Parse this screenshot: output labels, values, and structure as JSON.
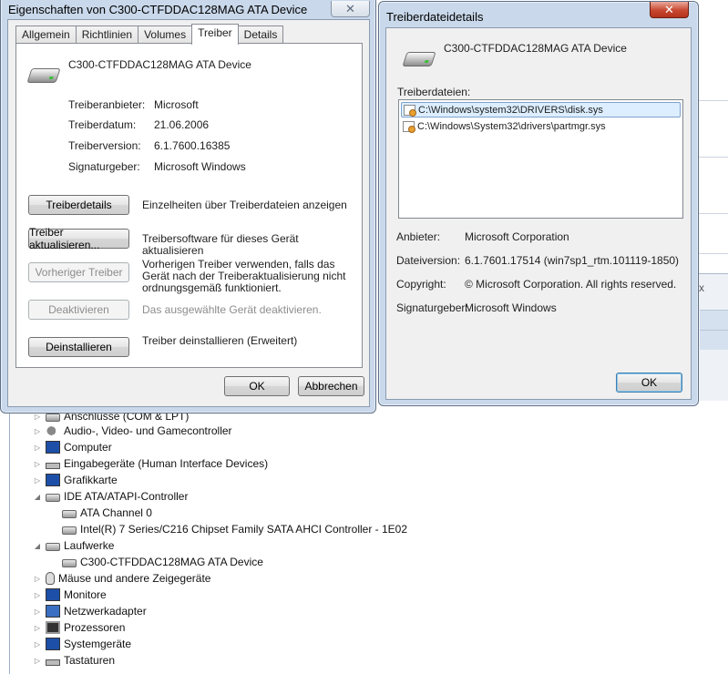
{
  "props_dialog": {
    "title": "Eigenschaften von C300-CTFDDAC128MAG ATA Device",
    "close_glyph": "✕",
    "tabs": [
      "Allgemein",
      "Richtlinien",
      "Volumes",
      "Treiber",
      "Details"
    ],
    "active_tab": "Treiber",
    "device_name": "C300-CTFDDAC128MAG ATA Device",
    "fields": [
      {
        "label": "Treiberanbieter:",
        "value": "Microsoft"
      },
      {
        "label": "Treiberdatum:",
        "value": "21.06.2006"
      },
      {
        "label": "Treiberversion:",
        "value": "6.1.7600.16385"
      },
      {
        "label": "Signaturgeber:",
        "value": "Microsoft Windows"
      }
    ],
    "actions": [
      {
        "button": "Treiberdetails",
        "description": "Einzelheiten über Treiberdateien anzeigen",
        "enabled": true
      },
      {
        "button": "Treiber aktualisieren...",
        "description": "Treibersoftware für dieses Gerät aktualisieren",
        "enabled": true
      },
      {
        "button": "Vorheriger Treiber",
        "description": "Vorherigen Treiber verwenden, falls das Gerät nach der Treiberaktualisierung nicht ordnungsgemäß funktioniert.",
        "enabled": false
      },
      {
        "button": "Deaktivieren",
        "description": "Das ausgewählte Gerät deaktivieren.",
        "enabled": false
      },
      {
        "button": "Deinstallieren",
        "description": "Treiber deinstallieren (Erweitert)",
        "enabled": true
      }
    ],
    "ok_label": "OK",
    "cancel_label": "Abbrechen"
  },
  "details_dialog": {
    "title": "Treiberdateidetails",
    "close_glyph": "✕",
    "device_name": "C300-CTFDDAC128MAG ATA Device",
    "files_label": "Treiberdateien:",
    "files": [
      "C:\\Windows\\system32\\DRIVERS\\disk.sys",
      "C:\\Windows\\System32\\drivers\\partmgr.sys"
    ],
    "selected_file_index": 0,
    "fields": [
      {
        "label": "Anbieter:",
        "value": "Microsoft Corporation"
      },
      {
        "label": "Dateiversion:",
        "value": "6.1.7601.17514 (win7sp1_rtm.101119-1850)"
      },
      {
        "label": "Copyright:",
        "value": "© Microsoft Corporation. All rights reserved."
      },
      {
        "label": "Signaturgeber:",
        "value": "Microsoft Windows"
      }
    ],
    "ok_label": "OK"
  },
  "device_tree": {
    "items": [
      {
        "label": "Anschlüsse (COM & LPT)",
        "icon": "port-icon",
        "level": 0,
        "expander": "▷"
      },
      {
        "label": "Audio-, Video- und Gamecontroller",
        "icon": "speaker-icon",
        "level": 0,
        "expander": "▷"
      },
      {
        "label": "Computer",
        "icon": "computer-icon",
        "level": 0,
        "expander": "▷"
      },
      {
        "label": "Eingabegeräte (Human Interface Devices)",
        "icon": "hid-icon",
        "level": 0,
        "expander": "▷"
      },
      {
        "label": "Grafikkarte",
        "icon": "display-adapter-icon",
        "level": 0,
        "expander": "▷"
      },
      {
        "label": "IDE ATA/ATAPI-Controller",
        "icon": "ide-controller-icon",
        "level": 0,
        "expander": "◢"
      },
      {
        "label": "ATA Channel 0",
        "icon": "ide-controller-icon",
        "level": 1,
        "expander": ""
      },
      {
        "label": "Intel(R) 7 Series/C216 Chipset Family SATA AHCI Controller - 1E02",
        "icon": "ide-controller-icon",
        "level": 1,
        "expander": ""
      },
      {
        "label": "Laufwerke",
        "icon": "drive-icon",
        "level": 0,
        "expander": "◢"
      },
      {
        "label": "C300-CTFDDAC128MAG ATA Device",
        "icon": "drive-icon",
        "level": 1,
        "expander": ""
      },
      {
        "label": "Mäuse und andere Zeigegeräte",
        "icon": "mouse-icon",
        "level": 0,
        "expander": "▷"
      },
      {
        "label": "Monitore",
        "icon": "monitor-icon",
        "level": 0,
        "expander": "▷"
      },
      {
        "label": "Netzwerkadapter",
        "icon": "network-adapter-icon",
        "level": 0,
        "expander": "▷"
      },
      {
        "label": "Prozessoren",
        "icon": "processor-icon",
        "level": 0,
        "expander": "▷"
      },
      {
        "label": "Systemgeräte",
        "icon": "system-device-icon",
        "level": 0,
        "expander": "▷"
      },
      {
        "label": "Tastaturen",
        "icon": "keyboard-icon",
        "level": 0,
        "expander": "▷"
      }
    ],
    "bg_close_glyph": "x"
  },
  "colors": {
    "title_glass": "#c9d8ea",
    "close_red": "#c8472f",
    "selection": "#dceeff",
    "dialog_face": "#f0f0f0"
  }
}
